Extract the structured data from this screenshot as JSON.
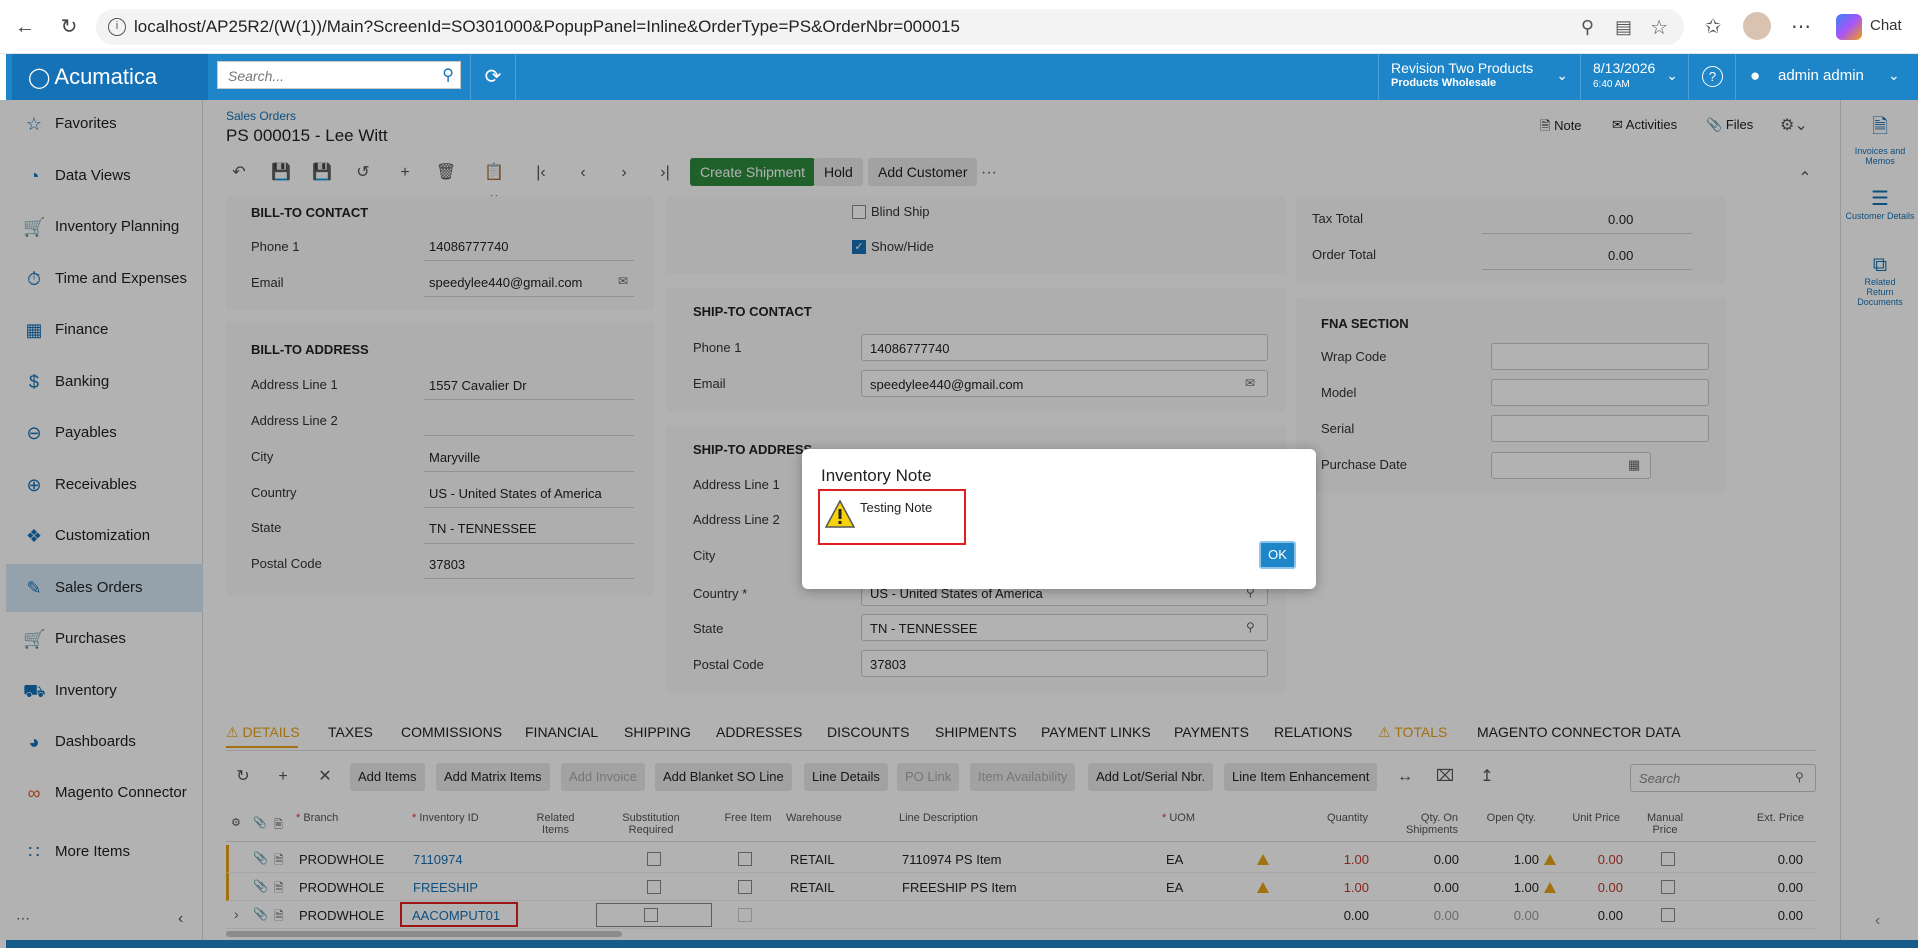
{
  "browser": {
    "url": "localhost/AP25R2/(W(1))/Main?ScreenId=SO301000&PopupPanel=Inline&OrderType=PS&OrderNbr=000015",
    "chat_label": "Chat"
  },
  "header": {
    "logo": "Acumatica",
    "search_placeholder": "Search...",
    "company": "Revision Two Products",
    "branch": "Products Wholesale",
    "date": "8/13/2026",
    "time": "6:40 AM",
    "user": "admin admin"
  },
  "sidebar": {
    "items": [
      {
        "label": "Favorites",
        "icon": "star-icon"
      },
      {
        "label": "Data Views",
        "icon": "pie-chart-icon"
      },
      {
        "label": "Inventory Planning",
        "icon": "cart-icon"
      },
      {
        "label": "Time and Expenses",
        "icon": "stopwatch-icon"
      },
      {
        "label": "Finance",
        "icon": "calculator-icon"
      },
      {
        "label": "Banking",
        "icon": "dollar-icon"
      },
      {
        "label": "Payables",
        "icon": "minus-circle-icon"
      },
      {
        "label": "Receivables",
        "icon": "plus-circle-icon"
      },
      {
        "label": "Customization",
        "icon": "puzzle-icon"
      },
      {
        "label": "Sales Orders",
        "icon": "edit-icon"
      },
      {
        "label": "Purchases",
        "icon": "cart-icon"
      },
      {
        "label": "Inventory",
        "icon": "truck-icon"
      },
      {
        "label": "Dashboards",
        "icon": "dashboard-icon"
      },
      {
        "label": "Magento Connector",
        "icon": "magento-icon"
      },
      {
        "label": "More Items",
        "icon": "grid-icon"
      }
    ]
  },
  "page": {
    "breadcrumb": "Sales Orders",
    "title": "PS 000015 - Lee Witt",
    "note": "Note",
    "activities": "Activities",
    "files": "Files"
  },
  "toolbar": {
    "create_shipment": "Create Shipment",
    "hold": "Hold",
    "add_customer": "Add Customer",
    "more": "···"
  },
  "bill_to_contact": {
    "title": "BILL-TO CONTACT",
    "phone_label": "Phone 1",
    "phone": "14086777740",
    "email_label": "Email",
    "email": "speedylee440@gmail.com"
  },
  "bill_to_address": {
    "title": "BILL-TO ADDRESS",
    "line1_label": "Address Line 1",
    "line1": "1557 Cavalier Dr",
    "line2_label": "Address Line 2",
    "line2": "",
    "city_label": "City",
    "city": "Maryville",
    "country_label": "Country",
    "country": "US - United States of America",
    "state_label": "State",
    "state": "TN - TENNESSEE",
    "postal_label": "Postal Code",
    "postal": "37803"
  },
  "options": {
    "blind_ship": "Blind Ship",
    "show_hide": "Show/Hide"
  },
  "ship_to_contact": {
    "title": "SHIP-TO CONTACT",
    "phone_label": "Phone 1",
    "phone": "14086777740",
    "email_label": "Email",
    "email": "speedylee440@gmail.com"
  },
  "ship_to_address": {
    "title": "SHIP-TO ADDRESS",
    "line1_label": "Address Line 1",
    "line2_label": "Address Line 2",
    "city_label": "City",
    "country_label": "Country *",
    "country": "US - United States of America",
    "state_label": "State",
    "state": "TN - TENNESSEE",
    "postal_label": "Postal Code",
    "postal": "37803"
  },
  "totals": {
    "tax_label": "Tax Total",
    "tax": "0.00",
    "order_label": "Order Total",
    "order": "0.00"
  },
  "fna": {
    "title": "FNA SECTION",
    "wrap_label": "Wrap Code",
    "model_label": "Model",
    "serial_label": "Serial",
    "purchase_label": "Purchase Date"
  },
  "tabs": [
    "DETAILS",
    "TAXES",
    "COMMISSIONS",
    "FINANCIAL",
    "SHIPPING",
    "ADDRESSES",
    "DISCOUNTS",
    "SHIPMENTS",
    "PAYMENT LINKS",
    "PAYMENTS",
    "RELATIONS",
    "TOTALS",
    "MAGENTO CONNECTOR DATA"
  ],
  "grid_toolbar": {
    "add_items": "Add Items",
    "add_matrix": "Add Matrix Items",
    "add_invoice": "Add Invoice",
    "add_blanket": "Add Blanket SO Line",
    "line_details": "Line Details",
    "po_link": "PO Link",
    "item_availability": "Item Availability",
    "add_lot": "Add Lot/Serial Nbr.",
    "line_item_enh": "Line Item Enhancement",
    "search_placeholder": "Search"
  },
  "grid_headers": {
    "branch": "Branch",
    "inventory_id": "Inventory ID",
    "related": "Related Items",
    "substitution": "Substitution Required",
    "free_item": "Free Item",
    "warehouse": "Warehouse",
    "line_desc": "Line Description",
    "uom": "UOM",
    "quantity": "Quantity",
    "qty_ship": "Qty. On Shipments",
    "open_qty": "Open Qty.",
    "unit_price": "Unit Price",
    "manual_price": "Manual Price",
    "ext_price": "Ext. Price"
  },
  "grid_rows": [
    {
      "branch": "PRODWHOLE",
      "inventory_id": "7110974",
      "warehouse": "RETAIL",
      "desc": "7110974 PS Item",
      "uom": "EA",
      "qty": "1.00",
      "qty_ship": "0.00",
      "open_qty": "1.00",
      "unit_price": "0.00",
      "ext_price": "0.00"
    },
    {
      "branch": "PRODWHOLE",
      "inventory_id": "FREESHIP",
      "warehouse": "RETAIL",
      "desc": "FREESHIP PS Item",
      "uom": "EA",
      "qty": "1.00",
      "qty_ship": "0.00",
      "open_qty": "1.00",
      "unit_price": "0.00",
      "ext_price": "0.00"
    },
    {
      "branch": "PRODWHOLE",
      "inventory_id": "AACOMPUT01",
      "warehouse": "",
      "desc": "",
      "uom": "",
      "qty": "0.00",
      "qty_ship": "0.00",
      "open_qty": "0.00",
      "unit_price": "0.00",
      "ext_price": "0.00"
    }
  ],
  "right_panel": {
    "invoices": "Invoices and Memos",
    "customer_details": "Customer Details",
    "related_return": "Related Return Documents"
  },
  "dialog": {
    "title": "Inventory Note",
    "message": "Testing Note",
    "ok": "OK"
  },
  "colors": {
    "brand": "#1e86c8",
    "action_green": "#2e8b3e",
    "warning": "#e8a317",
    "link": "#1572b6",
    "highlight": "#e02020"
  }
}
